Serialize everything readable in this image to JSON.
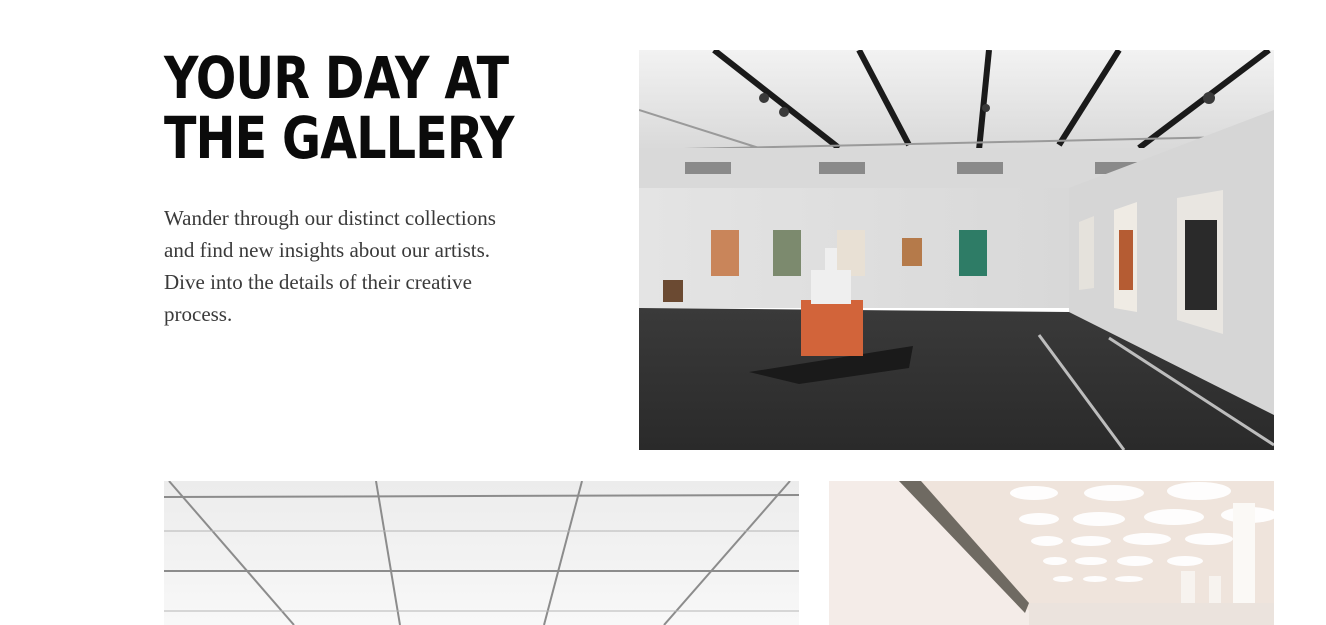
{
  "section": {
    "title_line1": "YOUR DAY AT",
    "title_line2": "THE GALLERY",
    "description": "Wander through our distinct collections and find new insights about our artists. Dive into the details of their creative process."
  },
  "images": {
    "main": "gallery-interior-photo",
    "ceiling": "gallery-ceiling-photo",
    "hall": "gallery-hall-photo"
  }
}
